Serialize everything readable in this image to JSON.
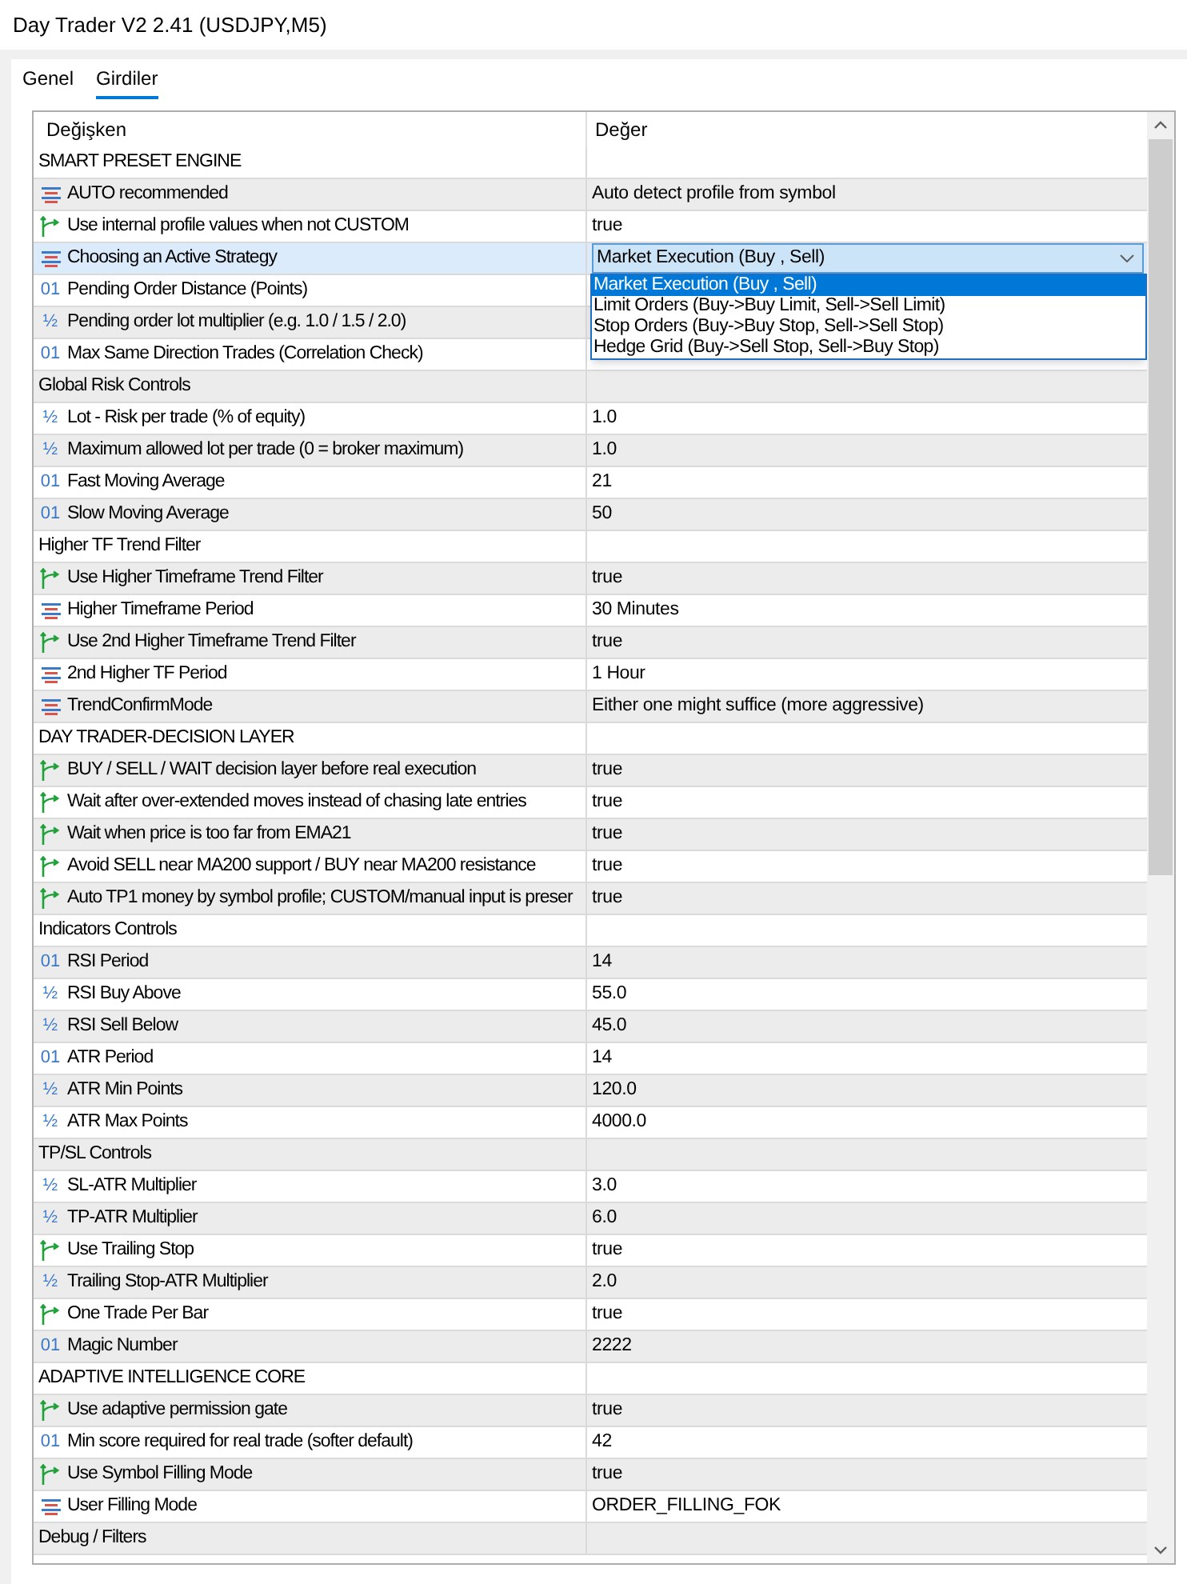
{
  "window": {
    "title": "Day Trader V2 2.41 (USDJPY,M5)"
  },
  "tabs": [
    {
      "label": "Genel",
      "selected": false
    },
    {
      "label": "Girdiler",
      "selected": true
    }
  ],
  "table": {
    "columns": [
      "Değişken",
      "Değer"
    ],
    "rows": [
      {
        "kind": "section",
        "name": "SMART PRESET ENGINE",
        "selected": false
      },
      {
        "kind": "enum",
        "name": "AUTO recommended",
        "value": "Auto detect profile from symbol",
        "selected": false
      },
      {
        "kind": "bool",
        "name": "Use internal profile values when not CUSTOM",
        "value": "true",
        "selected": false
      },
      {
        "kind": "enum",
        "name": "Choosing an Active Strategy",
        "value": "Market Execution (Buy , Sell)",
        "selected": true,
        "expanded": true,
        "options": [
          {
            "label": "Market Execution (Buy , Sell)",
            "selected": true
          },
          {
            "label": "Limit Orders (Buy->Buy Limit, Sell->Sell Limit)",
            "selected": false
          },
          {
            "label": "Stop Orders (Buy->Buy Stop, Sell->Sell Stop)",
            "selected": false
          },
          {
            "label": "Hedge Grid (Buy->Sell Stop, Sell->Buy Stop)",
            "selected": false
          }
        ]
      },
      {
        "kind": "int",
        "icon": "01",
        "name": "Pending Order Distance (Points)",
        "selected": false
      },
      {
        "kind": "double",
        "icon": "½",
        "name": "Pending order lot multiplier (e.g. 1.0 / 1.5 / 2.0)",
        "selected": false
      },
      {
        "kind": "int",
        "icon": "01",
        "name": "Max Same Direction Trades (Correlation Check)",
        "selected": false
      },
      {
        "kind": "section",
        "name": "Global Risk Controls",
        "selected": false
      },
      {
        "kind": "double",
        "icon": "½",
        "name": "Lot - Risk per trade (% of equity)",
        "value": "1.0",
        "selected": false
      },
      {
        "kind": "double",
        "icon": "½",
        "name": "Maximum allowed lot per trade (0 = broker maximum)",
        "value": "1.0",
        "selected": false
      },
      {
        "kind": "int",
        "icon": "01",
        "name": "Fast Moving Average",
        "value": "21",
        "selected": false
      },
      {
        "kind": "int",
        "icon": "01",
        "name": "Slow Moving Average",
        "value": "50",
        "selected": false
      },
      {
        "kind": "section",
        "name": "Higher TF Trend Filter",
        "selected": false
      },
      {
        "kind": "bool",
        "name": "Use Higher Timeframe Trend Filter",
        "value": "true",
        "selected": false
      },
      {
        "kind": "enum",
        "name": "Higher Timeframe Period",
        "value": "30 Minutes",
        "selected": false
      },
      {
        "kind": "bool",
        "name": "Use 2nd Higher Timeframe Trend Filter",
        "value": "true",
        "selected": false
      },
      {
        "kind": "enum",
        "name": "2nd Higher TF Period",
        "value": "1 Hour",
        "selected": false
      },
      {
        "kind": "enum",
        "name": "TrendConfirmMode",
        "value": "Either one might suffice (more aggressive)",
        "selected": false
      },
      {
        "kind": "section",
        "name": "DAY TRADER-DECISION LAYER",
        "selected": false
      },
      {
        "kind": "bool",
        "name": "BUY / SELL / WAIT decision layer before real execution",
        "value": "true",
        "selected": false
      },
      {
        "kind": "bool",
        "name": "Wait after over-extended moves instead of chasing late entries",
        "value": "true",
        "selected": false
      },
      {
        "kind": "bool",
        "name": "Wait when price is too far from EMA21",
        "value": "true",
        "selected": false
      },
      {
        "kind": "bool",
        "name": "Avoid SELL near MA200 support / BUY near MA200 resistance",
        "value": "true",
        "selected": false
      },
      {
        "kind": "bool",
        "name": "Auto TP1 money by symbol profile; CUSTOM/manual input is preser",
        "value": "true",
        "selected": false
      },
      {
        "kind": "section",
        "name": "Indicators Controls",
        "selected": false
      },
      {
        "kind": "int",
        "icon": "01",
        "name": "RSI Period",
        "value": "14",
        "selected": false
      },
      {
        "kind": "double",
        "icon": "½",
        "name": "RSI Buy Above",
        "value": "55.0",
        "selected": false
      },
      {
        "kind": "double",
        "icon": "½",
        "name": "RSI Sell Below",
        "value": "45.0",
        "selected": false
      },
      {
        "kind": "int",
        "icon": "01",
        "name": "ATR Period",
        "value": "14",
        "selected": false
      },
      {
        "kind": "double",
        "icon": "½",
        "name": "ATR Min Points",
        "value": "120.0",
        "selected": false
      },
      {
        "kind": "double",
        "icon": "½",
        "name": "ATR Max Points",
        "value": "4000.0",
        "selected": false
      },
      {
        "kind": "section",
        "name": "TP/SL Controls",
        "selected": false
      },
      {
        "kind": "double",
        "icon": "½",
        "name": "SL-ATR Multiplier",
        "value": "3.0",
        "selected": false
      },
      {
        "kind": "double",
        "icon": "½",
        "name": "TP-ATR Multiplier",
        "value": "6.0",
        "selected": false
      },
      {
        "kind": "bool",
        "name": "Use Trailing Stop",
        "value": "true",
        "selected": false
      },
      {
        "kind": "double",
        "icon": "½",
        "name": "Trailing Stop-ATR Multiplier",
        "value": "2.0",
        "selected": false
      },
      {
        "kind": "bool",
        "name": "One Trade Per Bar",
        "value": "true",
        "selected": false
      },
      {
        "kind": "int",
        "icon": "01",
        "name": "Magic Number",
        "value": "2222",
        "selected": false
      },
      {
        "kind": "section",
        "name": "ADAPTIVE INTELLIGENCE CORE",
        "selected": false
      },
      {
        "kind": "bool",
        "name": "Use adaptive permission gate",
        "value": "true",
        "selected": false
      },
      {
        "kind": "int",
        "icon": "01",
        "name": "Min score required for real trade (softer default)",
        "value": "42",
        "selected": false
      },
      {
        "kind": "bool",
        "name": "Use Symbol Filling Mode",
        "value": "true",
        "selected": false
      },
      {
        "kind": "enum",
        "name": "User Filling Mode",
        "value": "ORDER_FILLING_FOK",
        "selected": false
      },
      {
        "kind": "section",
        "name": "Debug / Filters",
        "selected": false
      }
    ]
  }
}
